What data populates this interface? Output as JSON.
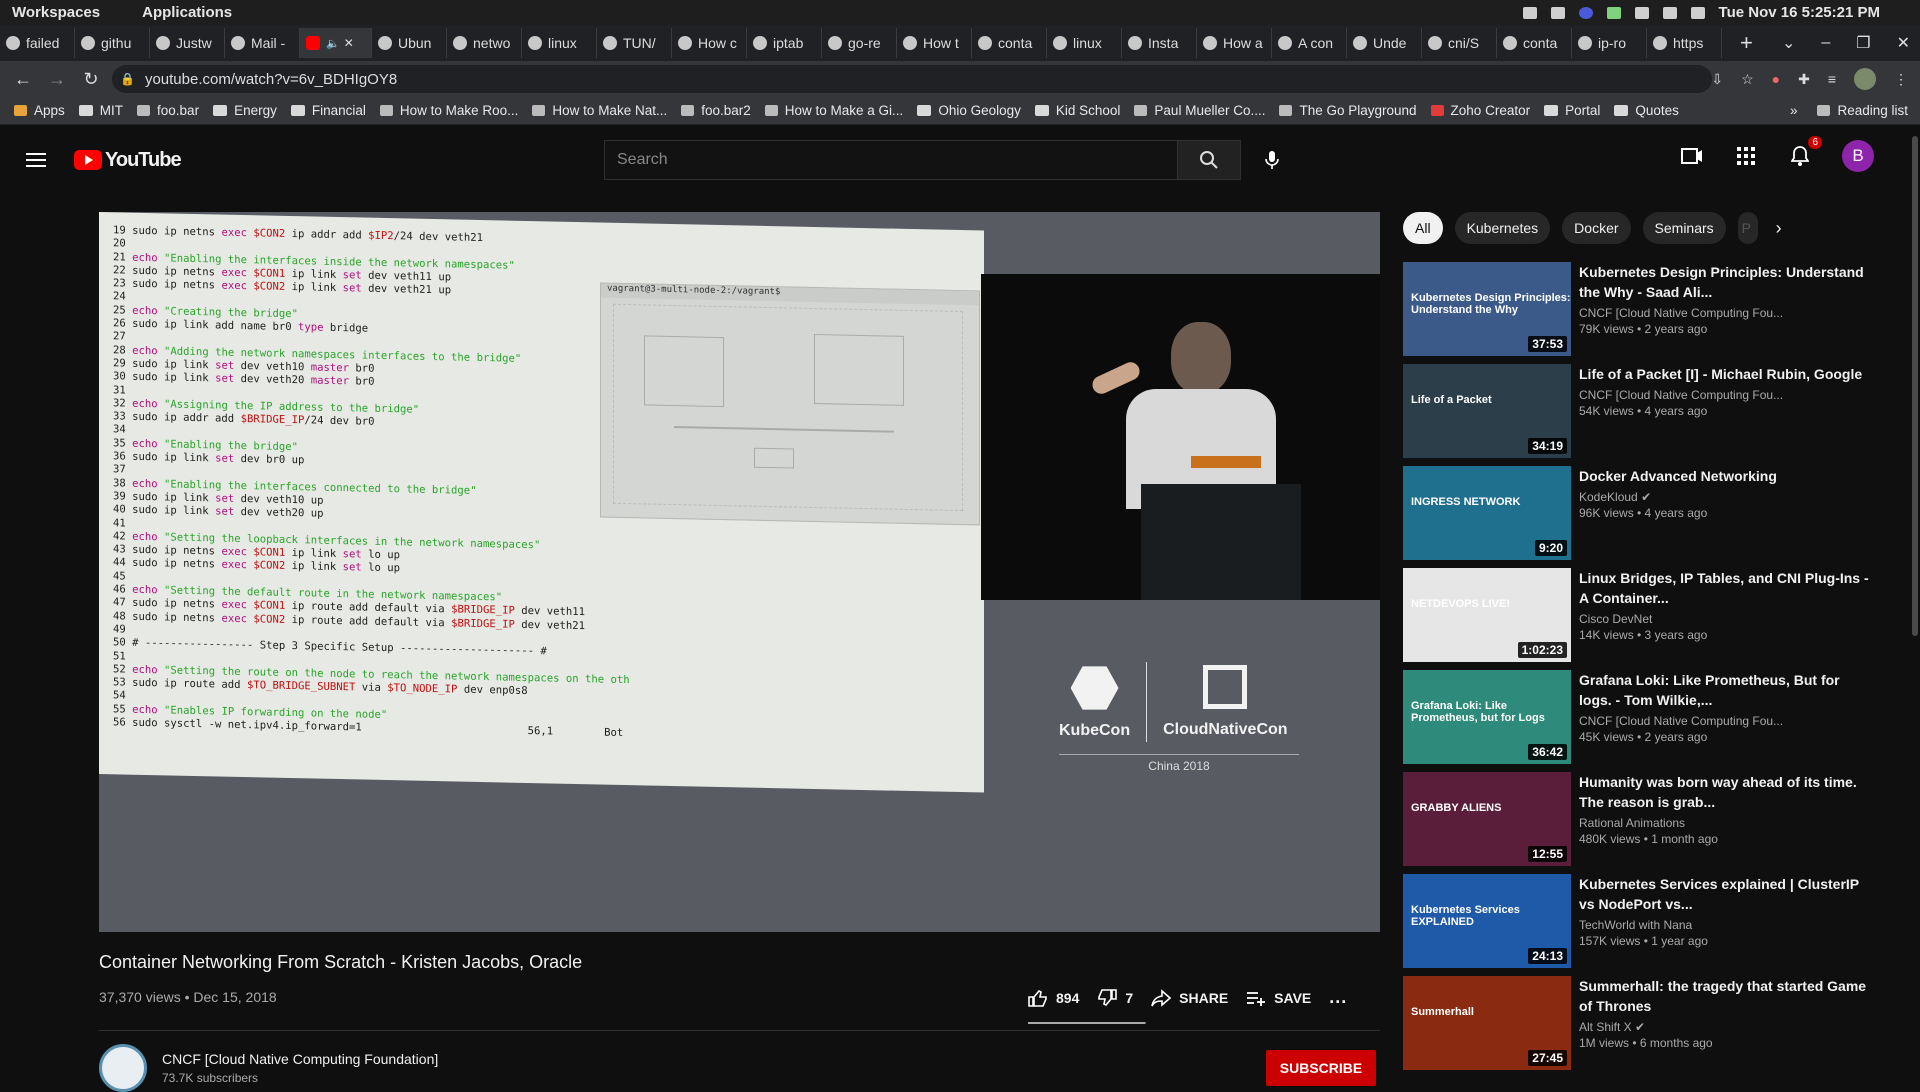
{
  "workspace_bar": {
    "workspaces": "Workspaces",
    "applications": "Applications",
    "clock": "Tue Nov 16   5:25:21 PM"
  },
  "tabs": [
    {
      "label": "failed",
      "icon": "google"
    },
    {
      "label": "githu",
      "icon": "google"
    },
    {
      "label": "Justw",
      "icon": "j"
    },
    {
      "label": "Mail -",
      "icon": "outlook"
    },
    {
      "label": "",
      "icon": "youtube",
      "active": true
    },
    {
      "label": "Ubun",
      "icon": "ubuntu"
    },
    {
      "label": "netwo",
      "icon": "k"
    },
    {
      "label": "linux",
      "icon": "bracket"
    },
    {
      "label": "TUN/",
      "icon": "w"
    },
    {
      "label": "How c",
      "icon": "globe"
    },
    {
      "label": "iptab",
      "icon": "k"
    },
    {
      "label": "go-re",
      "icon": "github"
    },
    {
      "label": "How t",
      "icon": "medium"
    },
    {
      "label": "conta",
      "icon": "dev"
    },
    {
      "label": "linux",
      "icon": "google"
    },
    {
      "label": "Insta",
      "icon": "book"
    },
    {
      "label": "How a",
      "icon": "k"
    },
    {
      "label": "A con",
      "icon": "star"
    },
    {
      "label": "Unde",
      "icon": "openai"
    },
    {
      "label": "cni/S",
      "icon": "github"
    },
    {
      "label": "conta",
      "icon": "github"
    },
    {
      "label": "ip-ro",
      "icon": "google"
    },
    {
      "label": "https",
      "icon": "globe"
    }
  ],
  "address": {
    "url": "youtube.com/watch?v=6v_BDHIgOY8"
  },
  "bookmarks": [
    {
      "label": "Apps",
      "icon": "apps"
    },
    {
      "label": "MIT",
      "icon": "folder"
    },
    {
      "label": "foo.bar",
      "icon": "google"
    },
    {
      "label": "Energy",
      "icon": "folder"
    },
    {
      "label": "Financial",
      "icon": "folder"
    },
    {
      "label": "How to Make Roo...",
      "icon": "page"
    },
    {
      "label": "How to Make Nat...",
      "icon": "page"
    },
    {
      "label": "foo.bar2",
      "icon": "google"
    },
    {
      "label": "How to Make a Gi...",
      "icon": "page"
    },
    {
      "label": "Ohio Geology",
      "icon": "folder"
    },
    {
      "label": "Kid School",
      "icon": "folder"
    },
    {
      "label": "Paul Mueller Co....",
      "icon": "page"
    },
    {
      "label": "The Go Playground",
      "icon": "page"
    },
    {
      "label": "Zoho Creator",
      "icon": "z"
    },
    {
      "label": "Portal",
      "icon": "folder"
    },
    {
      "label": "Quotes",
      "icon": "folder"
    }
  ],
  "bookmarks_right": {
    "reading_list": "Reading list"
  },
  "youtube": {
    "logo": "YouTube",
    "search_placeholder": "Search",
    "notifications_count": "6",
    "avatar_letter": "B"
  },
  "slide": {
    "lines": [
      "19 sudo ip netns exec $CON2 ip addr add $IP2/24 dev veth21",
      "20",
      "21 echo \"Enabling the interfaces inside the network namespaces\"",
      "22 sudo ip netns exec $CON1 ip link set dev veth11 up",
      "23 sudo ip netns exec $CON2 ip link set dev veth21 up",
      "24",
      "25 echo \"Creating the bridge\"",
      "26 sudo ip link add name br0 type bridge",
      "27",
      "28 echo \"Adding the network namespaces interfaces to the bridge\"",
      "29 sudo ip link set dev veth10 master br0",
      "30 sudo ip link set dev veth20 master br0",
      "31",
      "32 echo \"Assigning the IP address to the bridge\"",
      "33 sudo ip addr add $BRIDGE_IP/24 dev br0",
      "34",
      "35 echo \"Enabling the bridge\"",
      "36 sudo ip link set dev br0 up",
      "37",
      "38 echo \"Enabling the interfaces connected to the bridge\"",
      "39 sudo ip link set dev veth10 up",
      "40 sudo ip link set dev veth20 up",
      "41",
      "42 echo \"Setting the loopback interfaces in the network namespaces\"",
      "43 sudo ip netns exec $CON1 ip link set lo up",
      "44 sudo ip netns exec $CON2 ip link set lo up",
      "45",
      "46 echo \"Setting the default route in the network namespaces\"",
      "47 sudo ip netns exec $CON1 ip route add default via $BRIDGE_IP dev veth11",
      "48 sudo ip netns exec $CON2 ip route add default via $BRIDGE_IP dev veth21",
      "49",
      "50 # ----------------- Step 3 Specific Setup --------------------- #",
      "51",
      "52 echo \"Setting the route on the node to reach the network namespaces on the oth",
      "53 sudo ip route add $TO_BRIDGE_SUBNET via $TO_NODE_IP dev enp0s8",
      "54",
      "55 echo \"Enables IP forwarding on the node\"",
      "56 sudo sysctl -w net.ipv4.ip_forward=1                          56,1        Bot"
    ],
    "terminal_title": "vagrant@3-multi-node-2:/vagrant$",
    "kubecon": "KubeCon",
    "cloudnativecon": "CloudNativeCon",
    "event": "China 2018"
  },
  "video": {
    "title": "Container Networking From Scratch - Kristen Jacobs, Oracle",
    "meta": "37,370 views • Dec 15, 2018",
    "likes": "894",
    "dislikes": "7",
    "like_ratio": 0.992,
    "share": "SHARE",
    "save": "SAVE",
    "more": "..."
  },
  "channel": {
    "name": "CNCF [Cloud Native Computing Foundation]",
    "subscribers": "73.7K subscribers",
    "subscribe": "SUBSCRIBE"
  },
  "chips": [
    "All",
    "Kubernetes",
    "Docker",
    "Seminars",
    "P"
  ],
  "recommendations": [
    {
      "title": "Kubernetes Design Principles: Understand the Why - Saad Ali...",
      "channel": "CNCF [Cloud Native Computing Fou...",
      "meta": "79K views • 2 years ago",
      "duration": "37:53",
      "thumb_text": "Kubernetes Design Principles: Understand the Why",
      "bg": "#3b5a8a",
      "verified": false
    },
    {
      "title": "Life of a Packet [I] - Michael Rubin, Google",
      "channel": "CNCF [Cloud Native Computing Fou...",
      "meta": "54K views • 4 years ago",
      "duration": "34:19",
      "thumb_text": "Life of a Packet",
      "bg": "#2c3e4a",
      "verified": false
    },
    {
      "title": "Docker Advanced Networking",
      "channel": "KodeKloud",
      "meta": "96K views • 4 years ago",
      "duration": "9:20",
      "thumb_text": "INGRESS NETWORK",
      "bg": "#1f6f8f",
      "verified": true
    },
    {
      "title": "Linux Bridges, IP Tables, and CNI Plug-Ins - A Container...",
      "channel": "Cisco DevNet",
      "meta": "14K views • 3 years ago",
      "duration": "1:02:23",
      "thumb_text": "NETDEVOPS LIVE!",
      "bg": "#e6e6e6",
      "verified": false
    },
    {
      "title": "Grafana Loki: Like Prometheus, But for logs. - Tom Wilkie,...",
      "channel": "CNCF [Cloud Native Computing Fou...",
      "meta": "45K views • 2 years ago",
      "duration": "36:42",
      "thumb_text": "Grafana Loki: Like Prometheus, but for Logs",
      "bg": "#2e8a7a",
      "verified": false
    },
    {
      "title": "Humanity was born way ahead of its time. The reason is grab...",
      "channel": "Rational Animations",
      "meta": "480K views • 1 month ago",
      "duration": "12:55",
      "thumb_text": "GRABBY ALIENS",
      "bg": "#5a1e3a",
      "verified": false
    },
    {
      "title": "Kubernetes Services explained | ClusterIP vs NodePort vs...",
      "channel": "TechWorld with Nana",
      "meta": "157K views • 1 year ago",
      "duration": "24:13",
      "thumb_text": "Kubernetes Services EXPLAINED",
      "bg": "#1e5aa8",
      "verified": false
    },
    {
      "title": "Summerhall: the tragedy that started Game of Thrones",
      "channel": "Alt Shift X",
      "meta": "1M views • 6 months ago",
      "duration": "27:45",
      "thumb_text": "Summerhall",
      "bg": "#8a2a10",
      "verified": true
    }
  ]
}
